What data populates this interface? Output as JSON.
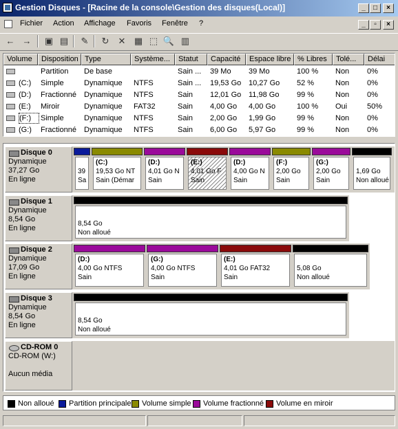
{
  "window": {
    "title": "Gestion Disques - [Racine de la console\\Gestion des disques(Local)]"
  },
  "menu": [
    "Fichier",
    "Action",
    "Affichage",
    "Favoris",
    "Fenêtre",
    "?"
  ],
  "menu_underline": [
    "F",
    "A",
    "c",
    "v",
    "ê",
    "?"
  ],
  "table": {
    "headers": [
      "Volume",
      "Disposition",
      "Type",
      "Système...",
      "Statut",
      "Capacité",
      "Espace libre",
      "% Libres",
      "Tolé...",
      "Délai"
    ],
    "rows": [
      [
        "",
        "Partition",
        "De base",
        "",
        "Sain ...",
        "39 Mo",
        "39 Mo",
        "100 %",
        "Non",
        "0%"
      ],
      [
        "(C:)",
        "Simple",
        "Dynamique",
        "NTFS",
        "Sain ...",
        "19,53 Go",
        "10,27 Go",
        "52 %",
        "Non",
        "0%"
      ],
      [
        "(D:)",
        "Fractionné",
        "Dynamique",
        "NTFS",
        "Sain",
        "12,01 Go",
        "11,98 Go",
        "99 %",
        "Non",
        "0%"
      ],
      [
        "(E:)",
        "Miroir",
        "Dynamique",
        "FAT32",
        "Sain",
        "4,00 Go",
        "4,00 Go",
        "100 %",
        "Oui",
        "50%"
      ],
      [
        "(F:)",
        "Simple",
        "Dynamique",
        "NTFS",
        "Sain",
        "2,00 Go",
        "1,99 Go",
        "99 %",
        "Non",
        "0%"
      ],
      [
        "(G:)",
        "Fractionné",
        "Dynamique",
        "NTFS",
        "Sain",
        "6,00 Go",
        "5,97 Go",
        "99 %",
        "Non",
        "0%"
      ]
    ]
  },
  "disks": [
    {
      "name": "Disque 0",
      "type": "Dynamique",
      "size": "37,27 Go",
      "state": "En ligne",
      "parts": [
        {
          "color": "#0a1a9a",
          "l1": "",
          "l2": "39",
          "l3": "Sa",
          "hatch": false
        },
        {
          "color": "#8a8a00",
          "l1": "(C:)",
          "l2": "19,53 Go NT",
          "l3": "Sain (Démar",
          "hatch": false
        },
        {
          "color": "#9a0a9a",
          "l1": "(D:)",
          "l2": "4,01 Go N",
          "l3": "Sain",
          "hatch": false
        },
        {
          "color": "#8a0a0a",
          "l1": "(E:)",
          "l2": "4,01 Go F",
          "l3": "Sain",
          "hatch": true
        },
        {
          "color": "#9a0a9a",
          "l1": "(D:)",
          "l2": "4,00 Go N",
          "l3": "Sain",
          "hatch": false
        },
        {
          "color": "#8a8a00",
          "l1": "(F:)",
          "l2": "2,00 Go",
          "l3": "Sain",
          "hatch": false
        },
        {
          "color": "#9a0a9a",
          "l1": "(G:)",
          "l2": "2,00 Go",
          "l3": "Sain",
          "hatch": false
        },
        {
          "color": "#000000",
          "l1": "",
          "l2": "1,69 Go",
          "l3": "Non alloué",
          "hatch": false
        }
      ]
    },
    {
      "name": "Disque 1",
      "type": "Dynamique",
      "size": "8,54 Go",
      "state": "En ligne",
      "parts": [
        {
          "color": "#000000",
          "l1": "",
          "l2": "8,54 Go",
          "l3": "Non alloué",
          "hatch": false
        }
      ]
    },
    {
      "name": "Disque 2",
      "type": "Dynamique",
      "size": "17,09 Go",
      "state": "En ligne",
      "parts": [
        {
          "color": "#9a0a9a",
          "l1": "(D:)",
          "l2": "4,00 Go NTFS",
          "l3": "Sain",
          "hatch": false
        },
        {
          "color": "#9a0a9a",
          "l1": "(G:)",
          "l2": "4,00 Go NTFS",
          "l3": "Sain",
          "hatch": false
        },
        {
          "color": "#8a0a0a",
          "l1": "(E:)",
          "l2": "4,01 Go FAT32",
          "l3": "Sain",
          "hatch": false
        },
        {
          "color": "#000000",
          "l1": "",
          "l2": "5,08 Go",
          "l3": "Non alloué",
          "hatch": false
        }
      ]
    },
    {
      "name": "Disque 3",
      "type": "Dynamique",
      "size": "8,54 Go",
      "state": "En ligne",
      "parts": [
        {
          "color": "#000000",
          "l1": "",
          "l2": "8,54 Go",
          "l3": "Non alloué",
          "hatch": false
        }
      ]
    }
  ],
  "cdrom": {
    "name": "CD-ROM 0",
    "line1": "CD-ROM (W:)",
    "line2": "Aucun média"
  },
  "legend": [
    {
      "color": "#000000",
      "label": "Non alloué"
    },
    {
      "color": "#0a1a9a",
      "label": "Partition principale"
    },
    {
      "color": "#8a8a00",
      "label": "Volume simple"
    },
    {
      "color": "#9a0a9a",
      "label": "Volume fractionné"
    },
    {
      "color": "#8a0a0a",
      "label": "Volume en miroir"
    }
  ],
  "caption_buttons": [
    "_",
    "□",
    "×"
  ],
  "inner_caption_buttons": [
    "_",
    "▫",
    "×"
  ],
  "toolbar_icons": [
    "←",
    "→",
    "▣",
    "▤",
    "✎",
    "↻",
    "✕",
    "▦",
    "⬚",
    "🔍",
    "▥"
  ]
}
